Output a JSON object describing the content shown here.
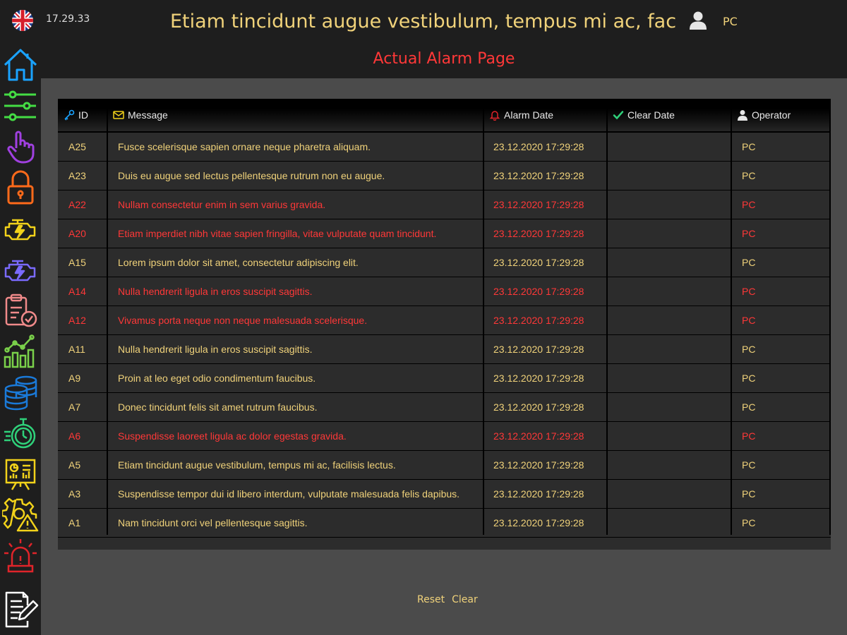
{
  "header": {
    "time": "17.29.33",
    "marquee": "Etiam tincidunt augue vestibulum, tempus mi ac, facilisis lectus.",
    "user": "PC"
  },
  "page": {
    "title": "Actual Alarm Page"
  },
  "nav": [
    {
      "icon": "home-icon"
    },
    {
      "icon": "sliders-icon"
    },
    {
      "icon": "hand-pointer-icon"
    },
    {
      "icon": "lock-icon"
    },
    {
      "icon": "engine-yellow-icon"
    },
    {
      "icon": "engine-purple-icon"
    },
    {
      "icon": "clipboard-check-icon"
    },
    {
      "icon": "trend-chart-icon"
    },
    {
      "icon": "database-icon"
    },
    {
      "icon": "stopwatch-icon"
    },
    {
      "icon": "presentation-board-icon"
    },
    {
      "icon": "gear-warning-icon"
    },
    {
      "icon": "alarm-siren-icon"
    },
    {
      "icon": "edit-document-icon"
    }
  ],
  "table": {
    "columns": {
      "id": "ID",
      "message": "Message",
      "alarm_date": "Alarm Date",
      "clear_date": "Clear Date",
      "operator": "Operator"
    },
    "rows": [
      {
        "id": "A25",
        "message": "Fusce scelerisque sapien ornare neque pharetra aliquam.",
        "alarm_date": "23.12.2020 17:29:28",
        "clear_date": "",
        "operator": "PC",
        "alarm": false
      },
      {
        "id": "A23",
        "message": "Duis eu augue sed lectus pellentesque rutrum non eu augue.",
        "alarm_date": "23.12.2020 17:29:28",
        "clear_date": "",
        "operator": "PC",
        "alarm": false
      },
      {
        "id": "A22",
        "message": "Nullam consectetur enim in sem varius gravida.",
        "alarm_date": "23.12.2020 17:29:28",
        "clear_date": "",
        "operator": "PC",
        "alarm": true
      },
      {
        "id": "A20",
        "message": "Etiam imperdiet nibh vitae sapien fringilla, vitae vulputate quam tincidunt.",
        "alarm_date": "23.12.2020 17:29:28",
        "clear_date": "",
        "operator": "PC",
        "alarm": true
      },
      {
        "id": "A15",
        "message": "Lorem ipsum dolor sit amet, consectetur adipiscing elit.",
        "alarm_date": "23.12.2020 17:29:28",
        "clear_date": "",
        "operator": "PC",
        "alarm": false
      },
      {
        "id": "A14",
        "message": "Nulla hendrerit ligula in eros suscipit sagittis.",
        "alarm_date": "23.12.2020 17:29:28",
        "clear_date": "",
        "operator": "PC",
        "alarm": true
      },
      {
        "id": "A12",
        "message": "Vivamus porta neque non neque malesuada scelerisque.",
        "alarm_date": "23.12.2020 17:29:28",
        "clear_date": "",
        "operator": "PC",
        "alarm": true
      },
      {
        "id": "A11",
        "message": "Nulla hendrerit ligula in eros suscipit sagittis.",
        "alarm_date": "23.12.2020 17:29:28",
        "clear_date": "",
        "operator": "PC",
        "alarm": false
      },
      {
        "id": "A9",
        "message": "Proin at leo eget odio condimentum faucibus.",
        "alarm_date": "23.12.2020 17:29:28",
        "clear_date": "",
        "operator": "PC",
        "alarm": false
      },
      {
        "id": "A7",
        "message": "Donec tincidunt felis sit amet rutrum faucibus.",
        "alarm_date": "23.12.2020 17:29:28",
        "clear_date": "",
        "operator": "PC",
        "alarm": false
      },
      {
        "id": "A6",
        "message": "Suspendisse laoreet ligula ac dolor egestas gravida.",
        "alarm_date": "23.12.2020 17:29:28",
        "clear_date": "",
        "operator": "PC",
        "alarm": true
      },
      {
        "id": "A5",
        "message": "Etiam tincidunt augue vestibulum, tempus mi ac, facilisis lectus.",
        "alarm_date": "23.12.2020 17:29:28",
        "clear_date": "",
        "operator": "PC",
        "alarm": false
      },
      {
        "id": "A3",
        "message": "Suspendisse tempor dui id libero interdum, vulputate malesuada felis dapibus.",
        "alarm_date": "23.12.2020 17:29:28",
        "clear_date": "",
        "operator": "PC",
        "alarm": false
      },
      {
        "id": "A1",
        "message": "Nam tincidunt orci vel pellentesque sagittis.",
        "alarm_date": "23.12.2020 17:29:28",
        "clear_date": "",
        "operator": "PC",
        "alarm": false
      }
    ]
  },
  "actions": {
    "reset": "Reset",
    "clear": "Clear"
  },
  "colors": {
    "normal_text": "#f0d27a",
    "alarm_text": "#ff3838",
    "panel": "#1e1e1e",
    "background": "#4b4b4b"
  }
}
